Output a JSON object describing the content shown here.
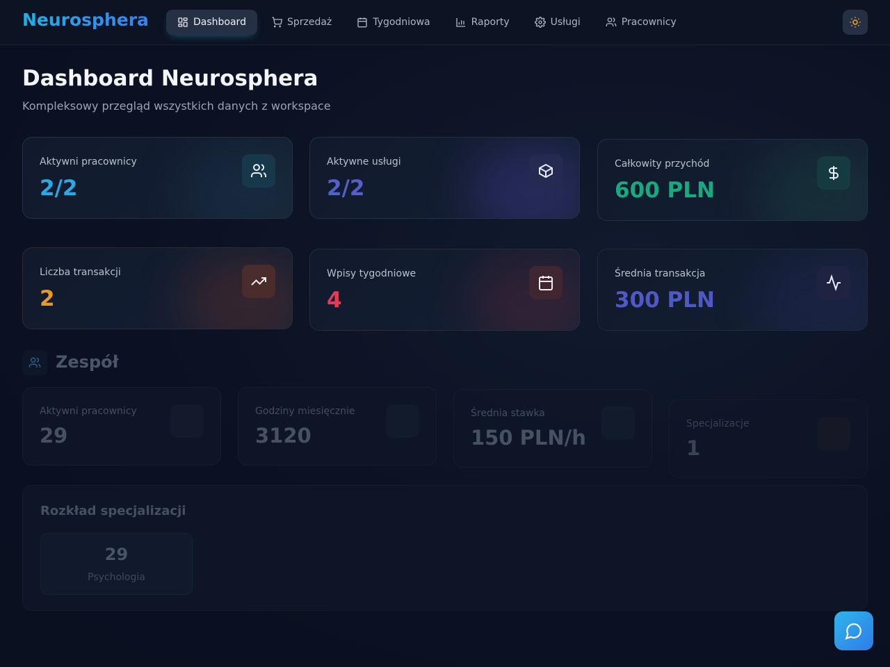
{
  "nav": {
    "brand": "Neurosphera",
    "items": [
      {
        "label": "Dashboard",
        "icon": "dashboard-grid-icon",
        "active": true
      },
      {
        "label": "Sprzedaż",
        "icon": "cart-icon"
      },
      {
        "label": "Tygodniowa",
        "icon": "calendar-icon"
      },
      {
        "label": "Raporty",
        "icon": "bar-chart-icon"
      },
      {
        "label": "Usługi",
        "icon": "gear-icon"
      },
      {
        "label": "Pracownicy",
        "icon": "users-icon"
      }
    ],
    "theme_icon": "sun-icon"
  },
  "header": {
    "title": "Dashboard Neurosphera",
    "subtitle": "Kompleksowy przegląd wszystkich danych z workspace"
  },
  "stats": [
    {
      "label": "Aktywni pracownicy",
      "value": "2/2",
      "icon": "users-icon",
      "color": "#2aa8e2"
    },
    {
      "label": "Aktywne usługi",
      "value": "2/2",
      "icon": "package-icon",
      "color": "#5360c8"
    },
    {
      "label": "Całkowity przychód",
      "value": "600 PLN",
      "icon": "dollar-icon",
      "color": "#17a97f"
    },
    {
      "label": "Liczba transakcji",
      "value": "2",
      "icon": "trending-up-icon",
      "color": "#e89a26"
    },
    {
      "label": "Wpisy tygodniowe",
      "value": "4",
      "icon": "calendar-icon",
      "color": "#e23c56"
    },
    {
      "label": "Średnia transakcja",
      "value": "300 PLN",
      "icon": "activity-icon",
      "color": "#5058c6"
    }
  ],
  "team": {
    "title": "Zespół",
    "stats": [
      {
        "label": "Aktywni pracownicy",
        "value": "29"
      },
      {
        "label": "Godziny miesięcznie",
        "value": "3120"
      },
      {
        "label": "Średnia stawka",
        "value": "150 PLN/h"
      },
      {
        "label": "Specjalizacje",
        "value": "1"
      }
    ],
    "distribution": {
      "title": "Rozkład specjalizacji",
      "items": [
        {
          "count": "29",
          "name": "Psychologia"
        }
      ]
    }
  },
  "chat_icon": "chat-bubble-icon"
}
